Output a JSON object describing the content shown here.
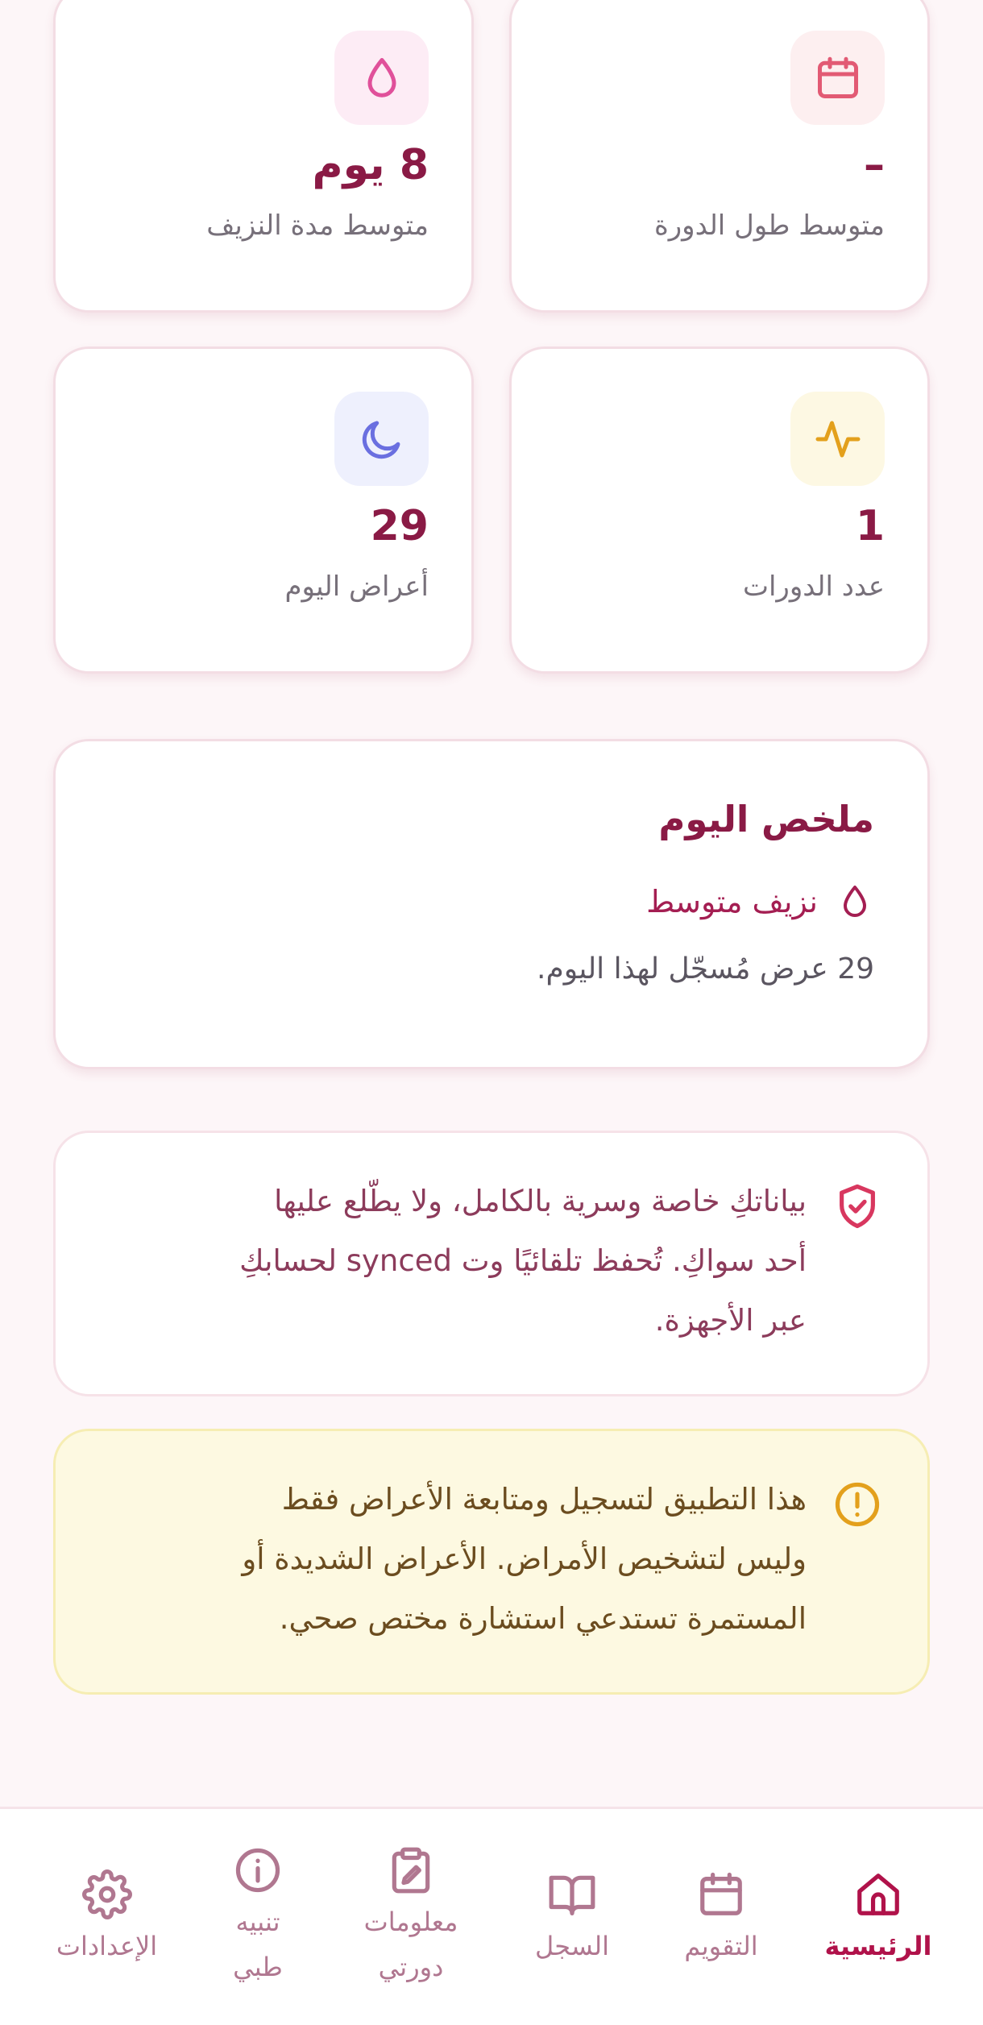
{
  "stats": {
    "avg_cycle": {
      "value": "–",
      "label": "متوسط طول الدورة",
      "icon": "calendar-icon",
      "icon_color": "#e25a74",
      "icon_bg": "#fdeff0"
    },
    "avg_bleeding": {
      "value": "8 يوم",
      "label": "متوسط مدة النزيف",
      "icon": "drop-icon",
      "icon_color": "#e0509a",
      "icon_bg": "#fdecf5"
    },
    "cycles_count": {
      "value": "1",
      "label": "عدد الدورات",
      "icon": "activity-icon",
      "icon_color": "#e3a01c",
      "icon_bg": "#fdf8e3"
    },
    "symptoms_today": {
      "value": "29",
      "label": "أعراض اليوم",
      "icon": "moon-icon",
      "icon_color": "#6a6fe0",
      "icon_bg": "#eef0fd"
    }
  },
  "summary": {
    "title": "ملخص اليوم",
    "flow": "نزيف متوسط",
    "count_text": "29 عرض مُسجّل لهذا اليوم."
  },
  "privacy_notice": {
    "line1": "بياناتكِ خاصة وسرية بالكامل، ولا يطّلع عليها",
    "line2": "أحد سواكِ. تُحفظ تلقائيًا وت synced لحسابكِ",
    "line3": "عبر الأجهزة."
  },
  "medical_disclaimer": {
    "line1": "هذا التطبيق لتسجيل ومتابعة الأعراض فقط",
    "line2": "وليس لتشخيص الأمراض. الأعراض الشديدة أو",
    "line3": "المستمرة تستدعي استشارة مختص صحي."
  },
  "nav": {
    "home": "الرئيسية",
    "calendar": "التقويم",
    "log": "السجل",
    "cycle_info_1": "معلومات",
    "cycle_info_2": "دورتي",
    "medical_1": "تنبيه",
    "medical_2": "طبي",
    "settings": "الإعدادات",
    "active": "home",
    "active_color": "#b0124a",
    "inactive_color": "#b07790"
  }
}
